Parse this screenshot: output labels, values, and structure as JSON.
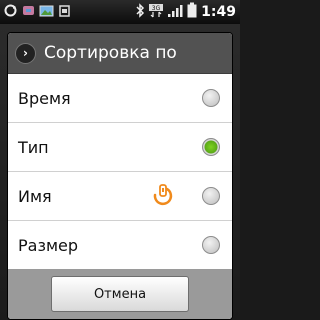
{
  "status_bar": {
    "time": "1:49",
    "network": "3G",
    "left_icons": [
      "sync-icon",
      "usb-icon",
      "picture-icon",
      "android-debug-icon"
    ],
    "right_icons": [
      "bluetooth-icon",
      "network-3g-icon",
      "signal-icon",
      "battery-icon"
    ]
  },
  "dialog": {
    "title": "Сортировка по",
    "options": [
      {
        "label": "Время",
        "selected": false
      },
      {
        "label": "Тип",
        "selected": true
      },
      {
        "label": "Имя",
        "selected": false
      },
      {
        "label": "Размер",
        "selected": false
      }
    ],
    "cancel_label": "Отмена"
  },
  "colors": {
    "header_bg": "#525252",
    "selected_radio": "#5aa818",
    "footer_bg": "#9a9a9a",
    "accent_orange": "#f08a1c"
  }
}
